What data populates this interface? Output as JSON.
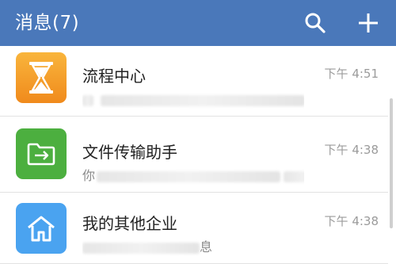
{
  "header": {
    "title": "消息(7)",
    "bg_color": "#4a78ba",
    "icons": {
      "search": "search-icon",
      "add": "plus-icon"
    }
  },
  "messages": [
    {
      "name": "流程中心",
      "time": "下午 4:51",
      "icon": "hourglass-icon",
      "icon_color": "#f5a623",
      "preview_prefix": "",
      "preview_suffix": ""
    },
    {
      "name": "文件传输助手",
      "time": "下午 4:38",
      "icon": "folder-icon",
      "icon_color": "#4caf3f",
      "preview_prefix": "你",
      "preview_suffix": "..."
    },
    {
      "name": "我的其他企业",
      "time": "下午 4:38",
      "icon": "home-icon",
      "icon_color": "#4aa3f0",
      "preview_prefix": "",
      "preview_suffix": "息"
    }
  ]
}
